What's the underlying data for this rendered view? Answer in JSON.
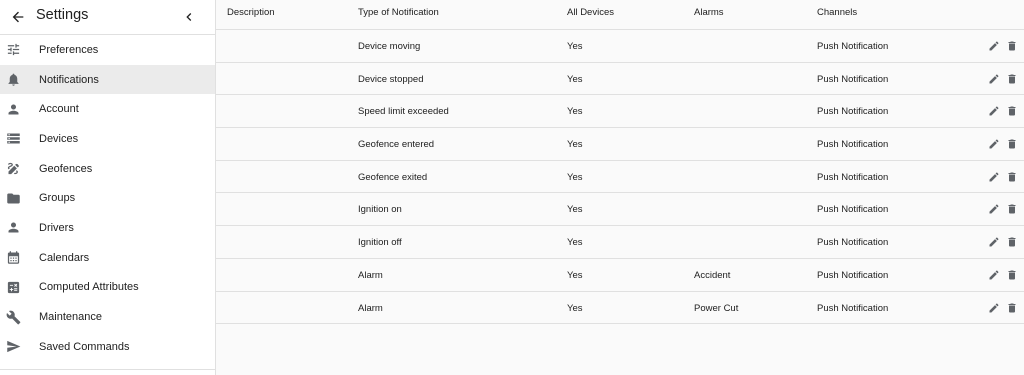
{
  "sidebar": {
    "title": "Settings",
    "back_icon": "arrow-back-icon",
    "collapse_icon": "chevron-left-icon",
    "items": [
      {
        "label": "Preferences",
        "icon": "tune-icon",
        "active": false
      },
      {
        "label": "Notifications",
        "icon": "bell-icon",
        "active": true
      },
      {
        "label": "Account",
        "icon": "person-icon",
        "active": false
      },
      {
        "label": "Devices",
        "icon": "storage-icon",
        "active": false
      },
      {
        "label": "Geofences",
        "icon": "draw-icon",
        "active": false
      },
      {
        "label": "Groups",
        "icon": "folder-icon",
        "active": false
      },
      {
        "label": "Drivers",
        "icon": "person-icon",
        "active": false
      },
      {
        "label": "Calendars",
        "icon": "calendar-icon",
        "active": false
      },
      {
        "label": "Computed Attributes",
        "icon": "calculate-icon",
        "active": false
      },
      {
        "label": "Maintenance",
        "icon": "wrench-icon",
        "active": false
      },
      {
        "label": "Saved Commands",
        "icon": "send-icon",
        "active": false
      }
    ]
  },
  "table": {
    "headers": {
      "description": "Description",
      "type": "Type of Notification",
      "all_devices": "All Devices",
      "alarms": "Alarms",
      "channels": "Channels"
    },
    "rows": [
      {
        "description": "",
        "type": "Device moving",
        "all_devices": "Yes",
        "alarms": "",
        "channels": "Push Notification"
      },
      {
        "description": "",
        "type": "Device stopped",
        "all_devices": "Yes",
        "alarms": "",
        "channels": "Push Notification"
      },
      {
        "description": "",
        "type": "Speed limit exceeded",
        "all_devices": "Yes",
        "alarms": "",
        "channels": "Push Notification"
      },
      {
        "description": "",
        "type": "Geofence entered",
        "all_devices": "Yes",
        "alarms": "",
        "channels": "Push Notification"
      },
      {
        "description": "",
        "type": "Geofence exited",
        "all_devices": "Yes",
        "alarms": "",
        "channels": "Push Notification"
      },
      {
        "description": "",
        "type": "Ignition on",
        "all_devices": "Yes",
        "alarms": "",
        "channels": "Push Notification"
      },
      {
        "description": "",
        "type": "Ignition off",
        "all_devices": "Yes",
        "alarms": "",
        "channels": "Push Notification"
      },
      {
        "description": "",
        "type": "Alarm",
        "all_devices": "Yes",
        "alarms": "Accident",
        "channels": "Push Notification"
      },
      {
        "description": "",
        "type": "Alarm",
        "all_devices": "Yes",
        "alarms": "Power Cut",
        "channels": "Push Notification"
      }
    ],
    "row_actions": {
      "edit_icon": "edit-pencil-icon",
      "delete_icon": "trash-icon"
    }
  },
  "colors": {
    "icon": "#5f6368",
    "active_bg": "#ebebeb",
    "divider": "#e0e0e0",
    "background": "#fafafa"
  }
}
